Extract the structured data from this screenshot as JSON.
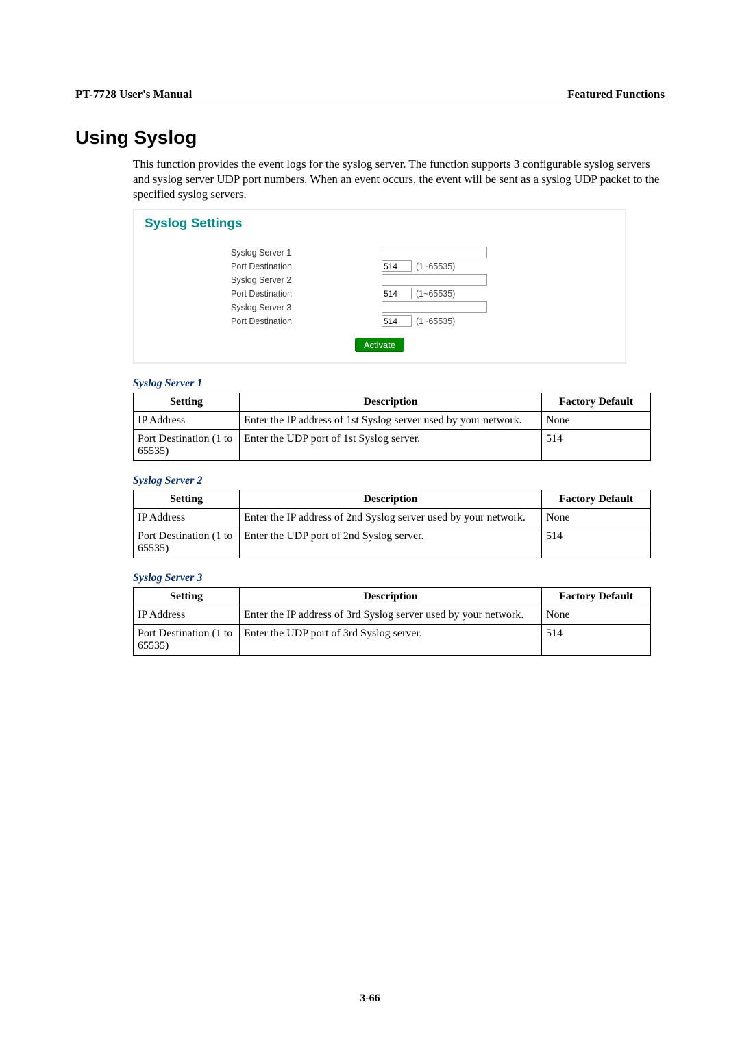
{
  "header": {
    "left": "PT-7728 User's Manual",
    "right": "Featured Functions"
  },
  "section_title": "Using Syslog",
  "intro_text": "This function provides the event logs for the syslog server. The function supports 3 configurable syslog servers and syslog server UDP port numbers. When an event occurs, the event will be sent as a syslog UDP packet to the specified syslog servers.",
  "panel": {
    "title": "Syslog Settings",
    "rows": [
      {
        "label": "Syslog Server 1",
        "value": "",
        "hint": ""
      },
      {
        "label": "Port Destination",
        "value": "514",
        "hint": "(1~65535)"
      },
      {
        "label": "Syslog Server 2",
        "value": "",
        "hint": ""
      },
      {
        "label": "Port Destination",
        "value": "514",
        "hint": "(1~65535)"
      },
      {
        "label": "Syslog Server 3",
        "value": "",
        "hint": ""
      },
      {
        "label": "Port Destination",
        "value": "514",
        "hint": "(1~65535)"
      }
    ],
    "activate_label": "Activate"
  },
  "tables": [
    {
      "caption": "Syslog Server 1",
      "headers": [
        "Setting",
        "Description",
        "Factory Default"
      ],
      "rows": [
        [
          "IP Address",
          "Enter the IP address of 1st Syslog server used by your network.",
          "None"
        ],
        [
          "Port Destination (1 to 65535)",
          "Enter the UDP port of 1st Syslog server.",
          "514"
        ]
      ]
    },
    {
      "caption": "Syslog Server 2",
      "headers": [
        "Setting",
        "Description",
        "Factory Default"
      ],
      "rows": [
        [
          "IP Address",
          "Enter the IP address of 2nd Syslog server used by your network.",
          "None"
        ],
        [
          "Port Destination (1 to 65535)",
          "Enter the UDP port of 2nd Syslog server.",
          "514"
        ]
      ]
    },
    {
      "caption": "Syslog Server 3",
      "headers": [
        "Setting",
        "Description",
        "Factory Default"
      ],
      "rows": [
        [
          "IP Address",
          "Enter the IP address of 3rd Syslog server used by your network.",
          "None"
        ],
        [
          "Port Destination (1 to 65535)",
          "Enter the UDP port of 3rd Syslog server.",
          "514"
        ]
      ]
    }
  ],
  "page_number": "3-66"
}
